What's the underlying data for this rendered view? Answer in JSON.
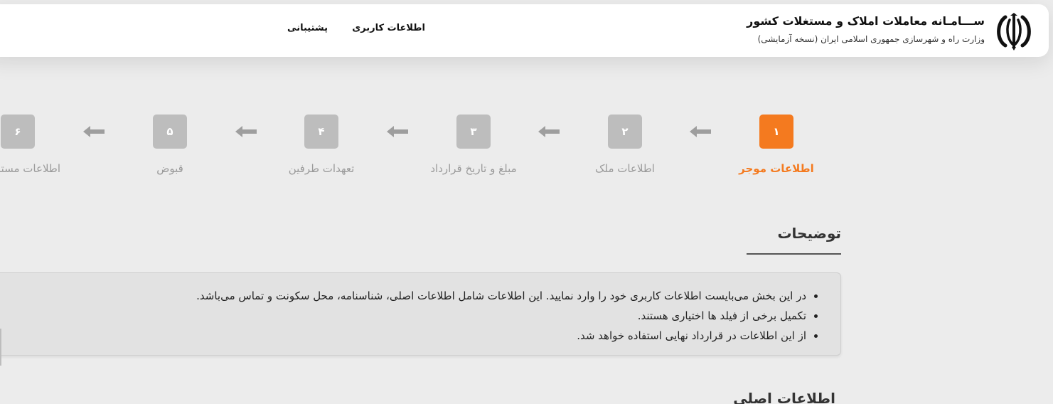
{
  "header": {
    "title": "ســـامـانه معاملات املاک و مستغلات کشور",
    "subtitle": "وزارت راه و شهرسازی جمهوری اسلامی ایران (نسخه آزمایشی)",
    "nav": {
      "user_info": "اطلاعات کاربری",
      "support": "پشتیبانی"
    }
  },
  "stepper": {
    "steps": [
      {
        "number": "۱",
        "label": "اطلاعات موجر",
        "active": true
      },
      {
        "number": "۲",
        "label": "اطلاعات ملک",
        "active": false
      },
      {
        "number": "۳",
        "label": "مبلغ و تاریخ قرارداد",
        "active": false
      },
      {
        "number": "۴",
        "label": "تعهدات طرفین",
        "active": false
      },
      {
        "number": "۵",
        "label": "قبوض",
        "active": false
      },
      {
        "number": "۶",
        "label": "اطلاعات مستاجر",
        "active": false
      }
    ]
  },
  "description": {
    "title": "توضیحات",
    "items": [
      "در این بخش می‌بایست اطلاعات کاربری خود را وارد نمایید. این اطلاعات شامل اطلاعات اصلی، شناسنامه، محل سکونت و تماس می‌باشد.",
      "تکمیل برخی از فیلد ها اختیاری هستند.",
      "از این اطلاعات در قرارداد نهایی استفاده خواهد شد."
    ]
  },
  "next_section": {
    "title": "اطلاعات اصلی"
  },
  "colors": {
    "accent": "#f47a1f",
    "inactive_step": "#bdbdbd",
    "background": "#ececec"
  },
  "icons": {
    "emblem": "iran-emblem-icon",
    "step_arrow": "arrow-left-icon"
  }
}
